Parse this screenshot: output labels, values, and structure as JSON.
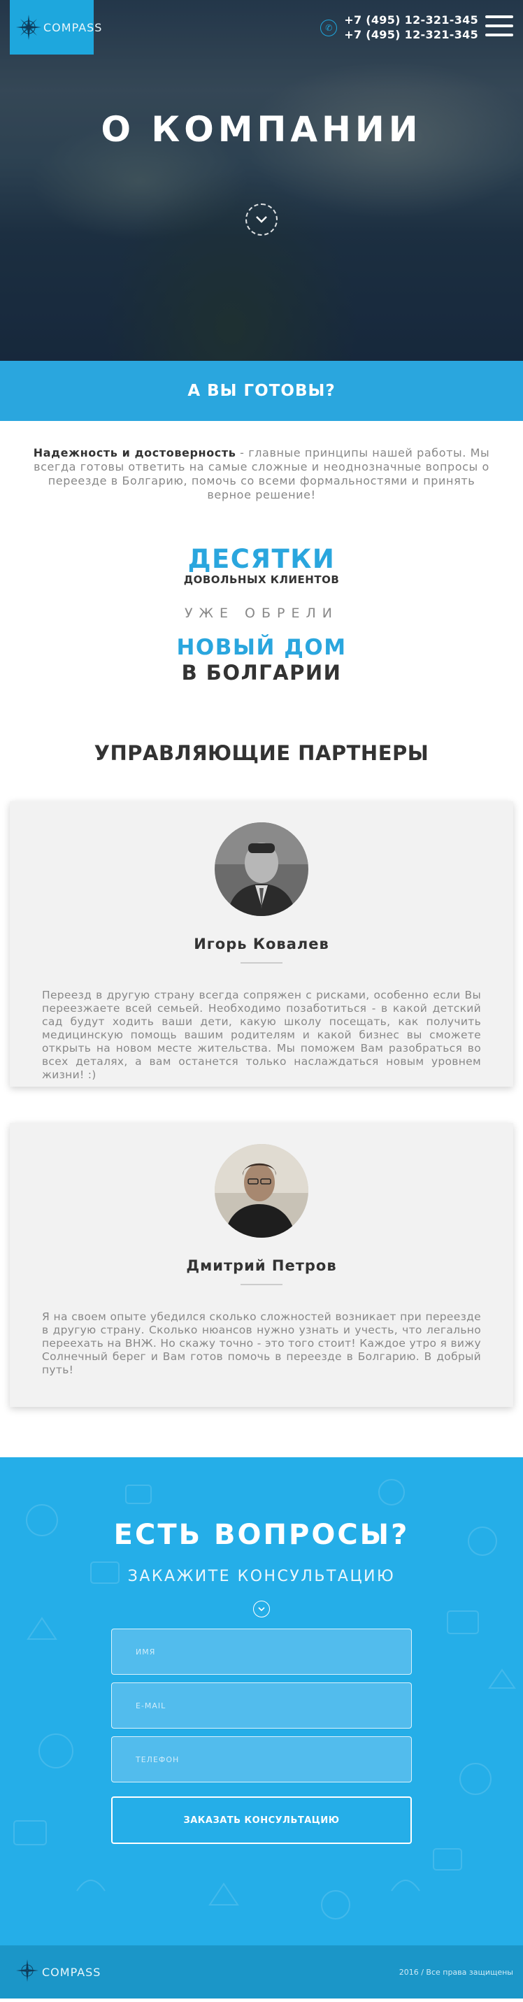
{
  "header": {
    "logo_text": "COMPASS",
    "phones": [
      "+7 (495) 12-321-345",
      "+7 (495) 12-321-345"
    ],
    "phone_icon": "phone-icon",
    "menu_icon": "hamburger-icon"
  },
  "hero": {
    "title": "О КОМПАНИИ",
    "down_icon": "chevron-down-icon"
  },
  "ready": {
    "title": "А ВЫ ГОТОВЫ?"
  },
  "intro": {
    "bold": "Надежность и достоверность",
    "text": " - главные принципы нашей работы. Мы всегда готовы ответить на самые сложные и неоднозначные вопросы о переезде в Болгарию, помочь со всеми формальностями и принять верное решение!"
  },
  "stats": {
    "big": "ДЕСЯТКИ",
    "sub": "ДОВОЛЬНЫХ КЛИЕНТОВ",
    "mid": "УЖЕ ОБРЕЛИ",
    "big2": "НОВЫЙ ДОМ",
    "dark": "В БОЛГАРИИ"
  },
  "partners": {
    "title": "УПРАВЛЯЮЩИЕ ПАРТНЕРЫ",
    "items": [
      {
        "name": "Игорь Ковалев",
        "text": "Переезд в другую страну всегда сопряжен с рисками, особенно если Вы переезжаете всей семьей. Необходимо позаботиться - в какой детский сад будут ходить ваши дети, какую школу посещать, как получить медицинскую помощь вашим родителям и какой бизнес вы сможете открыть на новом месте жительства. Мы поможем Вам разобраться во всех деталях, а вам останется только наслаждаться новым уровнем жизни! :)"
      },
      {
        "name": "Дмитрий Петров",
        "text": "Я на своем опыте убедился сколько сложностей возникает при переезде в другую страну. Сколько нюансов нужно узнать и учесть, что легально переехать на ВНЖ. Но скажу точно - это того стоит! Каждое утро я вижу Солнечный берег и Вам готов помочь в переезде в Болгарию. В добрый путь!"
      }
    ]
  },
  "questions": {
    "title": "ЕСТЬ ВОПРОСЫ?",
    "subtitle": "ЗАКАЖИТЕ КОНСУЛЬТАЦИЮ",
    "name_placeholder": "ИМЯ",
    "email_placeholder": "E-MAIL",
    "phone_placeholder": "ТЕЛЕФОН",
    "submit_label": "ЗАКАЗАТЬ КОНСУЛЬТАЦИЮ"
  },
  "footer": {
    "logo_text": "COMPASS",
    "copyright": "2016 / Все права защищены"
  },
  "colors": {
    "accent": "#2aa6de",
    "logo_bg": "#1ea7dd",
    "questions_bg": "#25aee8",
    "footer_bg": "#1b96c8",
    "card_bg": "#f2f2f2"
  }
}
